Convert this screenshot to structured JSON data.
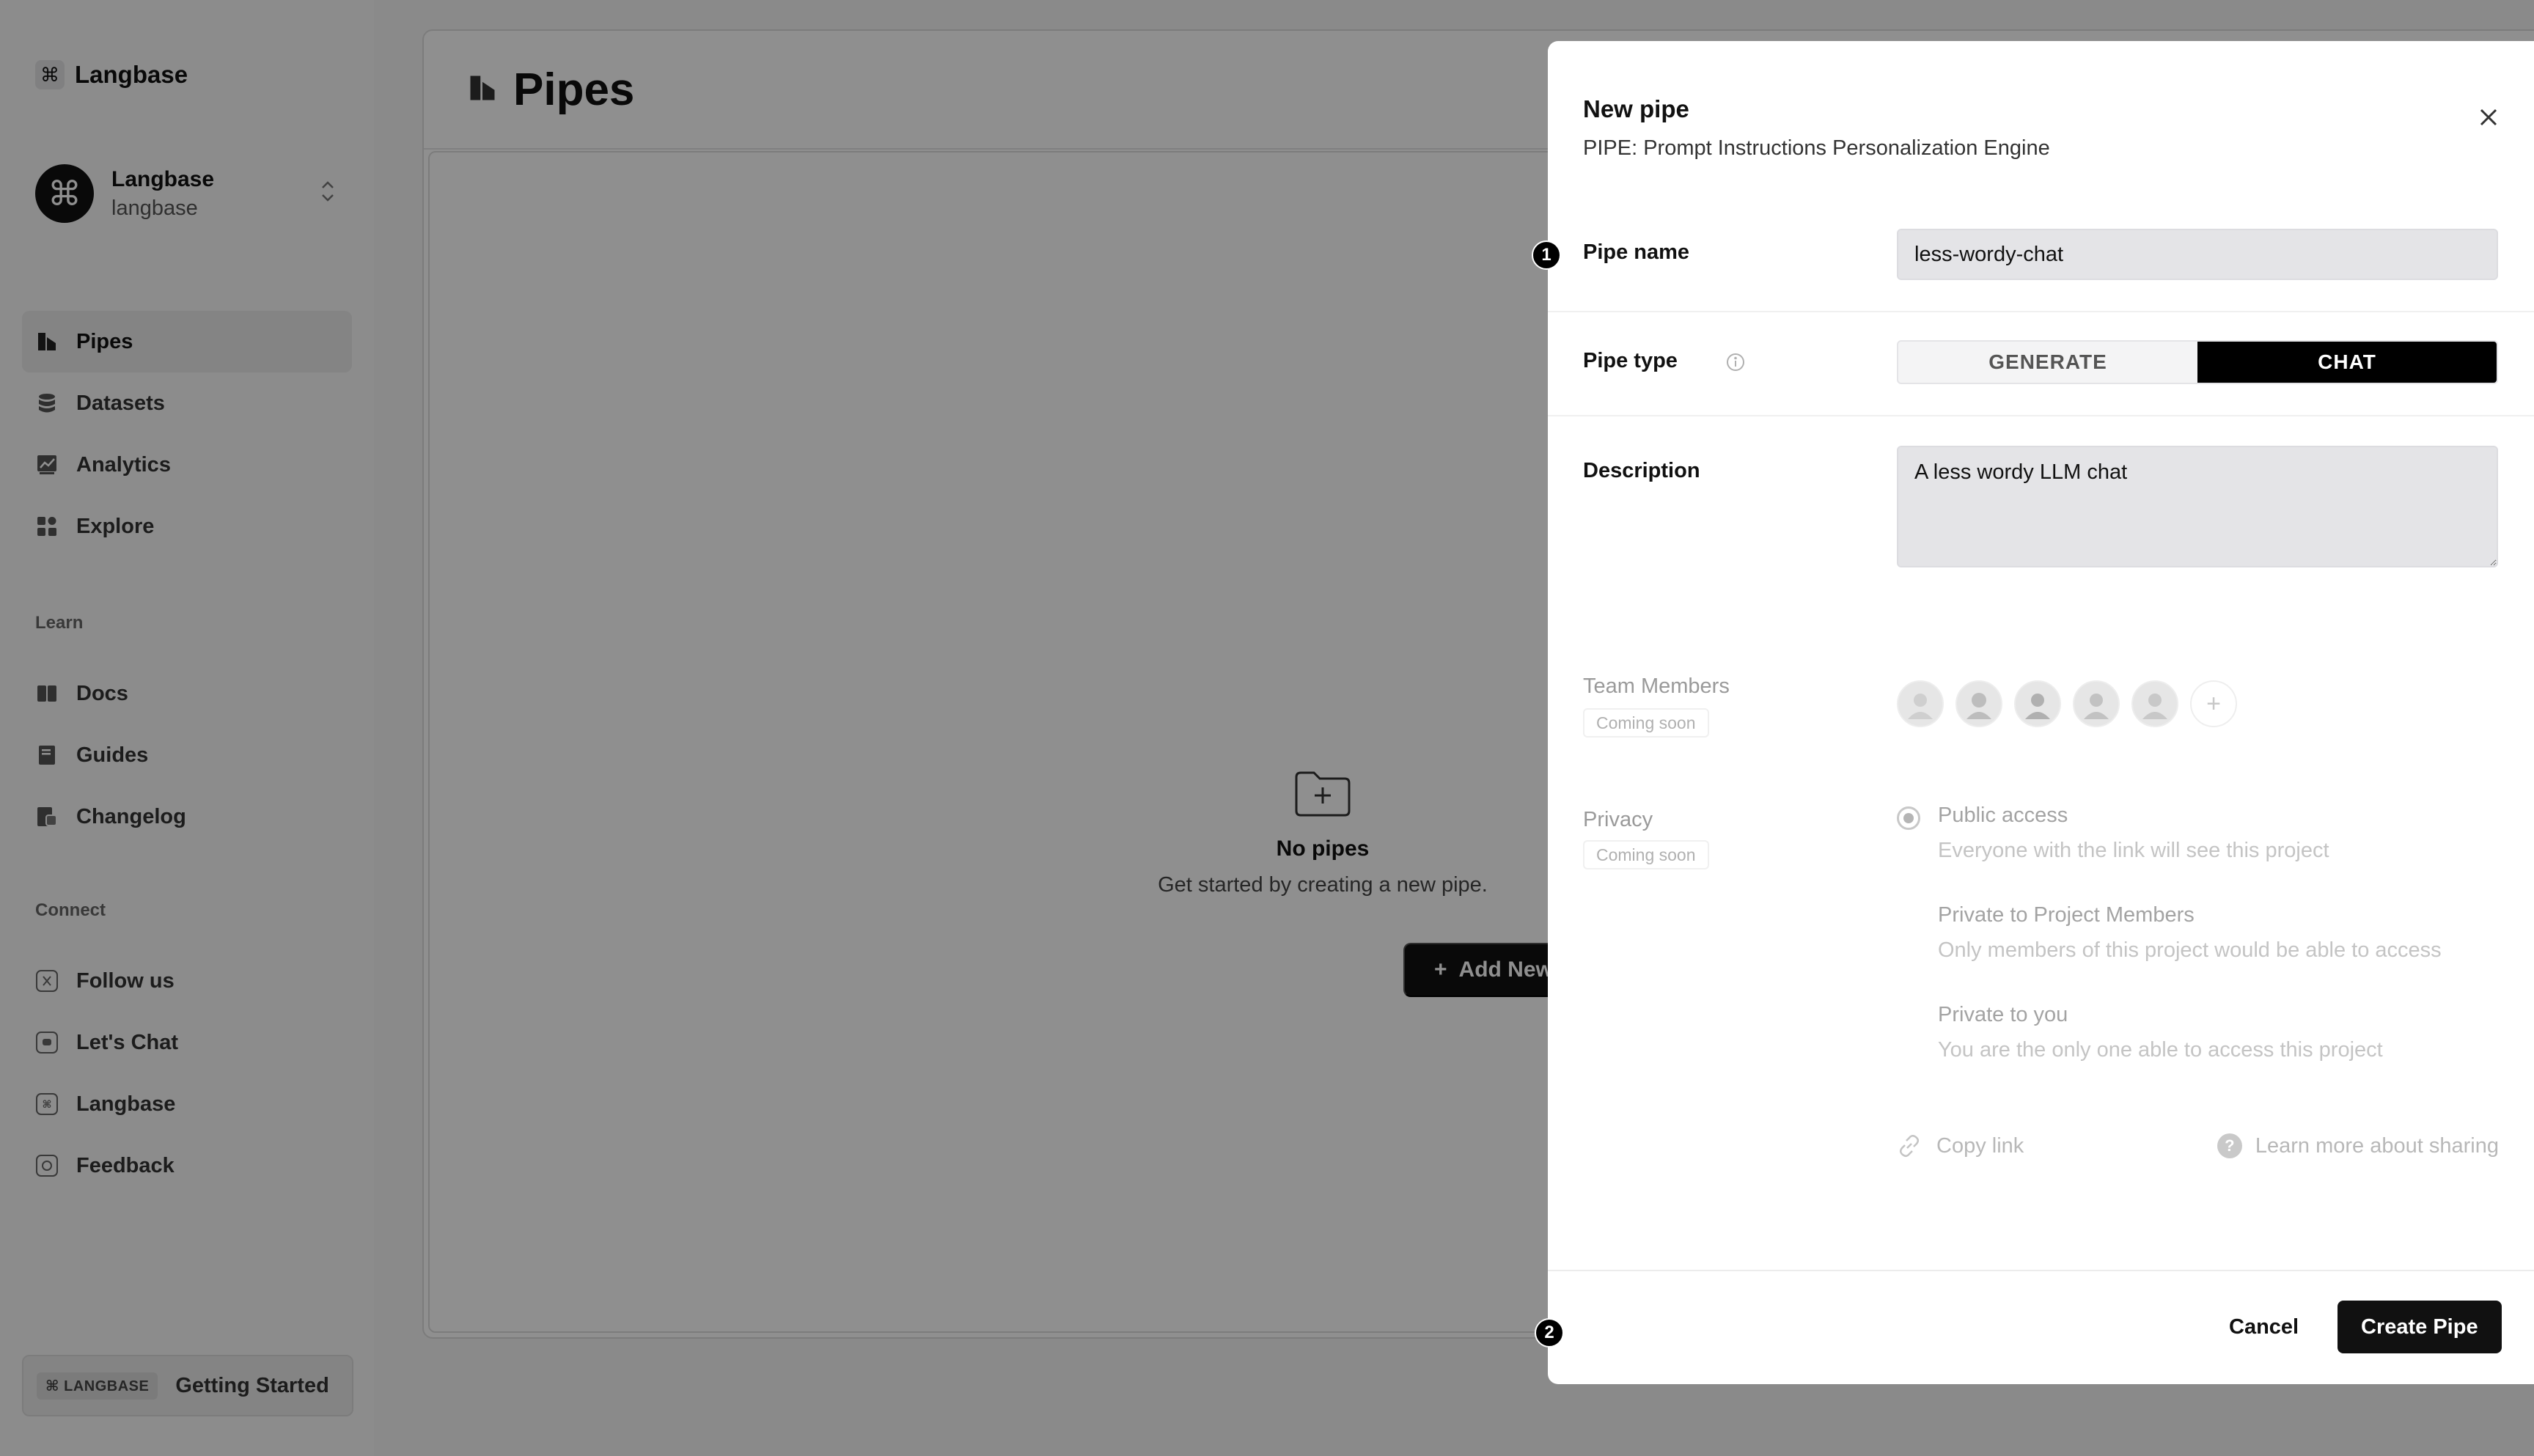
{
  "sidebar": {
    "brand": {
      "logo_glyph": "⌘",
      "name": "Langbase"
    },
    "account": {
      "avatar_glyph": "⌘",
      "name": "Langbase",
      "handle": "langbase",
      "switch_icon": "chevron-up-down-icon"
    },
    "nav_main": [
      {
        "label": "Pipes",
        "icon": "pipes-icon",
        "active": true
      },
      {
        "label": "Datasets",
        "icon": "database-icon",
        "active": false
      },
      {
        "label": "Analytics",
        "icon": "chart-icon",
        "active": false
      },
      {
        "label": "Explore",
        "icon": "grid-icon",
        "active": false
      }
    ],
    "learn_label": "Learn",
    "nav_learn": [
      {
        "label": "Docs",
        "icon": "book-icon"
      },
      {
        "label": "Guides",
        "icon": "guide-icon"
      },
      {
        "label": "Changelog",
        "icon": "changelog-icon"
      }
    ],
    "connect_label": "Connect",
    "nav_connect": [
      {
        "label": "Follow us",
        "icon": "x-icon"
      },
      {
        "label": "Let's Chat",
        "icon": "discord-icon"
      },
      {
        "label": "Langbase",
        "icon": "langbase-icon"
      },
      {
        "label": "Feedback",
        "icon": "feedback-icon"
      }
    ],
    "getting_started": {
      "badge": "⌘ LANGBASE",
      "label": "Getting Started"
    }
  },
  "main": {
    "title": "Pipes",
    "empty": {
      "title": "No pipes",
      "subtitle": "Get started by creating a new pipe.",
      "button_label": "Add New"
    }
  },
  "modal": {
    "title": "New pipe",
    "subtitle": "PIPE: Prompt Instructions Personalization Engine",
    "pipe_name": {
      "label": "Pipe name",
      "value": "less-wordy-chat"
    },
    "pipe_type": {
      "label": "Pipe type",
      "options": [
        "GENERATE",
        "CHAT"
      ],
      "selected": "CHAT"
    },
    "description": {
      "label": "Description",
      "value": "A less wordy LLM chat"
    },
    "team_members": {
      "label": "Team Members",
      "badge": "Coming soon",
      "avatar_count": 5
    },
    "privacy": {
      "label": "Privacy",
      "badge": "Coming soon",
      "options": [
        {
          "title": "Public access",
          "desc": "Everyone with the link will see this project",
          "checked": true
        },
        {
          "title": "Private to Project Members",
          "desc": "Only members of this project would be able to access",
          "checked": false
        },
        {
          "title": "Private to you",
          "desc": "You are the only one able to access this project",
          "checked": false
        }
      ]
    },
    "copy_link": "Copy link",
    "learn_more": "Learn more about sharing",
    "help_glyph": "?",
    "cancel": "Cancel",
    "create": "Create Pipe"
  },
  "steps": {
    "one": "1",
    "two": "2"
  }
}
